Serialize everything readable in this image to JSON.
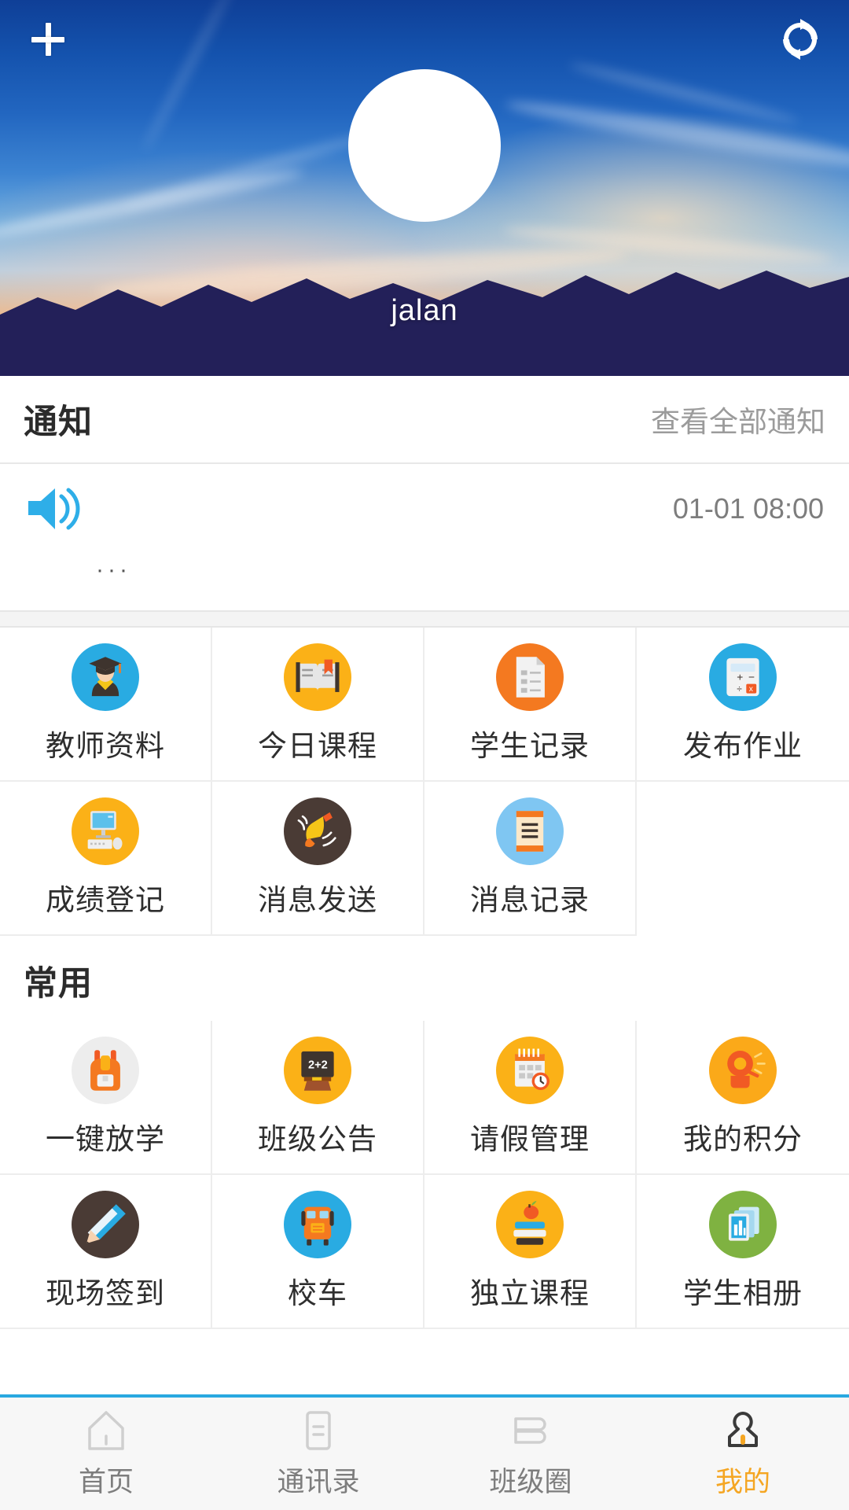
{
  "header": {
    "add_icon": "plus-icon",
    "refresh_icon": "refresh-icon",
    "avatar_icon": "avatar",
    "user_name": "jalan"
  },
  "notice": {
    "title": "通知",
    "more_label": "查看全部通知",
    "speaker_icon": "speaker-icon",
    "time": "01-01 08:00",
    "text": "···"
  },
  "sections": [
    {
      "name": "functions",
      "title": "",
      "items": [
        {
          "label": "教师资料",
          "icon": "graduate-icon",
          "color": "#29ABE2"
        },
        {
          "label": "今日课程",
          "icon": "book-icon",
          "color": "#FBB117"
        },
        {
          "label": "学生记录",
          "icon": "document-icon",
          "color": "#F47920"
        },
        {
          "label": "发布作业",
          "icon": "calculator-icon",
          "color": "#29ABE2"
        },
        {
          "label": "成绩登记",
          "icon": "computer-icon",
          "color": "#FBB117"
        },
        {
          "label": "消息发送",
          "icon": "bell-icon",
          "color": "#4A3B35"
        },
        {
          "label": "消息记录",
          "icon": "note-icon",
          "color": "#7FC6F2"
        }
      ]
    },
    {
      "name": "common",
      "title": "常用",
      "items": [
        {
          "label": "一键放学",
          "icon": "backpack-icon",
          "color": "#EDEDED"
        },
        {
          "label": "班级公告",
          "icon": "blackboard-icon",
          "color": "#FBB117"
        },
        {
          "label": "请假管理",
          "icon": "calendar-icon",
          "color": "#FBB117"
        },
        {
          "label": "我的积分",
          "icon": "alarm-icon",
          "color": "#FBA919"
        },
        {
          "label": "现场签到",
          "icon": "pencil-icon",
          "color": "#4A3B35"
        },
        {
          "label": "校车",
          "icon": "schoolbus-icon",
          "color": "#29ABE2"
        },
        {
          "label": "独立课程",
          "icon": "books-icon",
          "color": "#FBB117"
        },
        {
          "label": "学生相册",
          "icon": "photos-icon",
          "color": "#7FB241"
        }
      ]
    }
  ],
  "tabbar": {
    "accent_color": "#f5a623",
    "border_color": "#29a8e0",
    "items": [
      {
        "label": "首页",
        "icon": "home-icon",
        "active": false
      },
      {
        "label": "通讯录",
        "icon": "contacts-icon",
        "active": false
      },
      {
        "label": "班级圈",
        "icon": "feed-icon",
        "active": false
      },
      {
        "label": "我的",
        "icon": "person-icon",
        "active": true
      }
    ]
  }
}
